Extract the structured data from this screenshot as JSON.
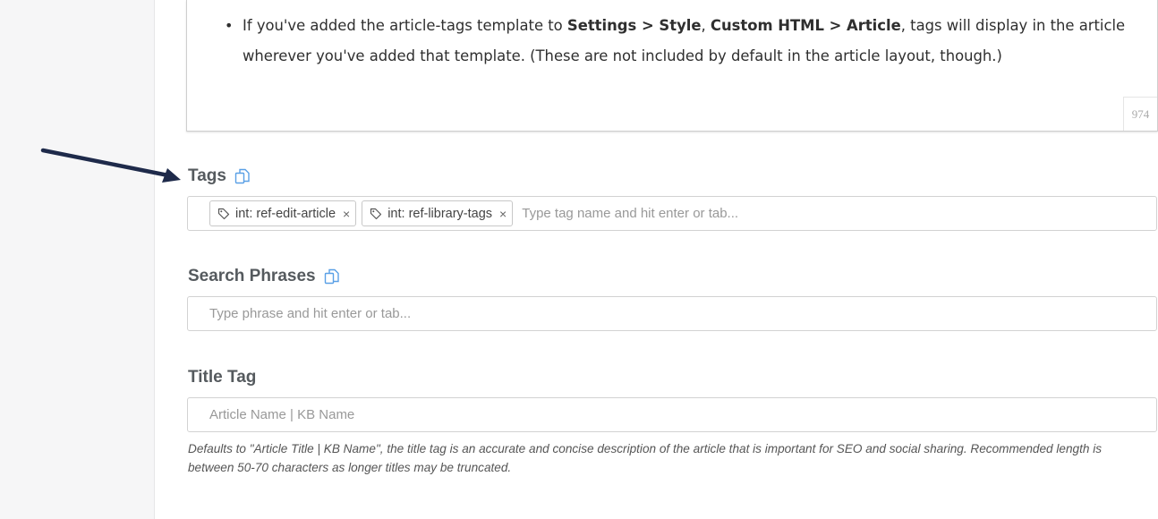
{
  "editor": {
    "bullet_prefix": "If you've added the article-tags template to ",
    "bold_1": "Settings > Style",
    "sep": ", ",
    "bold_2": "Custom HTML > Article",
    "bullet_suffix": ", tags will display in the article wherever you've added that template. (These are not included by default in the article layout, though.)",
    "char_count": "974"
  },
  "tags": {
    "label": "Tags",
    "items": [
      {
        "label": "int: ref-edit-article",
        "remove": "×"
      },
      {
        "label": "int: ref-library-tags",
        "remove": "×"
      }
    ],
    "placeholder": "Type tag name and hit enter or tab..."
  },
  "search_phrases": {
    "label": "Search Phrases",
    "placeholder": "Type phrase and hit enter or tab..."
  },
  "title_tag": {
    "label": "Title Tag",
    "placeholder": "Article Name | KB Name",
    "help": "Defaults to \"Article Title | KB Name\", the title tag is an accurate and concise description of the article that is important for SEO and social sharing. Recommended length is between 50-70 characters as longer titles may be truncated."
  },
  "icons": {
    "copy": "copy-icon",
    "tag": "tag-icon",
    "arrow": "arrow-annotation"
  },
  "colors": {
    "accent": "#5aa0e6",
    "arrow": "#1e2a4a"
  }
}
